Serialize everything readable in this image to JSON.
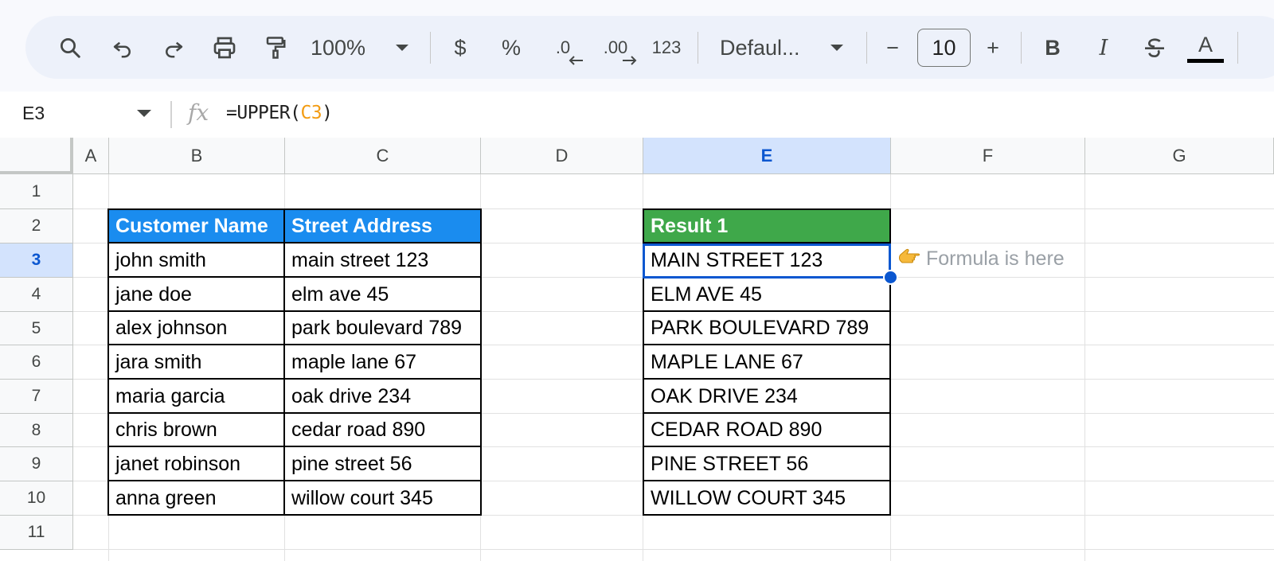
{
  "toolbar": {
    "zoom": "100%",
    "currency": "$",
    "percent": "%",
    "more_formats": "123",
    "font_family": "Defaul...",
    "font_size": "10",
    "decrease_font": "−",
    "increase_font": "+",
    "bold": "B",
    "italic": "I",
    "text_color": "A",
    "dec_decimal": ".0",
    "inc_decimal": ".00"
  },
  "formula_bar": {
    "name_box": "E3",
    "fx": "fx",
    "formula_prefix": "=UPPER(",
    "formula_ref": "C3",
    "formula_suffix": ")"
  },
  "grid": {
    "columns": [
      "A",
      "B",
      "C",
      "D",
      "E",
      "F",
      "G"
    ],
    "rows": [
      "1",
      "2",
      "3",
      "4",
      "5",
      "6",
      "7",
      "8",
      "9",
      "10",
      "11"
    ],
    "selected_column": "E",
    "selected_row": "3",
    "selected_cell": "E3"
  },
  "table1": {
    "headers": [
      "Customer Name",
      "Street Address"
    ],
    "header_color": "#1a8cef",
    "rows": [
      [
        "john smith",
        "main street 123"
      ],
      [
        "jane doe",
        "elm ave 45"
      ],
      [
        "alex johnson",
        "park boulevard 789"
      ],
      [
        "jara smith",
        "maple lane 67"
      ],
      [
        "maria garcia",
        "oak drive 234"
      ],
      [
        "chris brown",
        "cedar road 890"
      ],
      [
        "janet robinson",
        "pine street 56"
      ],
      [
        "anna green",
        "willow court 345"
      ]
    ]
  },
  "table2": {
    "header": "Result 1",
    "header_color": "#3fa84a",
    "rows": [
      "MAIN STREET 123",
      "ELM AVE 45",
      "PARK BOULEVARD 789",
      "MAPLE LANE 67",
      "OAK DRIVE 234",
      "CEDAR ROAD 890",
      "PINE STREET 56",
      "WILLOW COURT 345"
    ]
  },
  "note": {
    "icon": "pointing-hand-icon",
    "text": "Formula is here"
  }
}
